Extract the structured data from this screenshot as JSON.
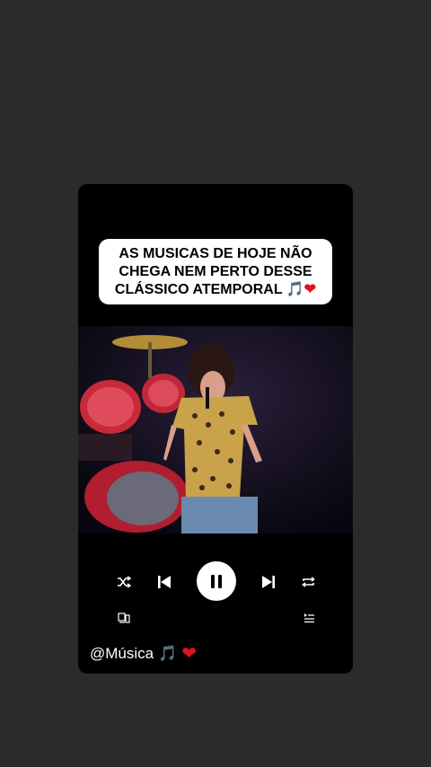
{
  "caption": {
    "line1": "AS MUSICAS DE HOJE NÃO",
    "line2": "CHEGA NEM PERTO DESSE",
    "line3_text": "CLÁSSICO ATEMPORAL ",
    "music_emoji": "🎵",
    "heart_emoji": "❤"
  },
  "player": {
    "shuffle_icon": "shuffle-icon",
    "previous_icon": "skip-previous-icon",
    "pause_icon": "pause-icon",
    "next_icon": "skip-next-icon",
    "repeat_icon": "repeat-icon",
    "devices_icon": "devices-icon",
    "queue_icon": "queue-icon"
  },
  "handle": {
    "text": "@Música",
    "music_emoji": "🎵",
    "heart_emoji": "❤"
  },
  "colors": {
    "background": "#2b2b2b",
    "card": "#000000",
    "heart": "#d9141f"
  }
}
